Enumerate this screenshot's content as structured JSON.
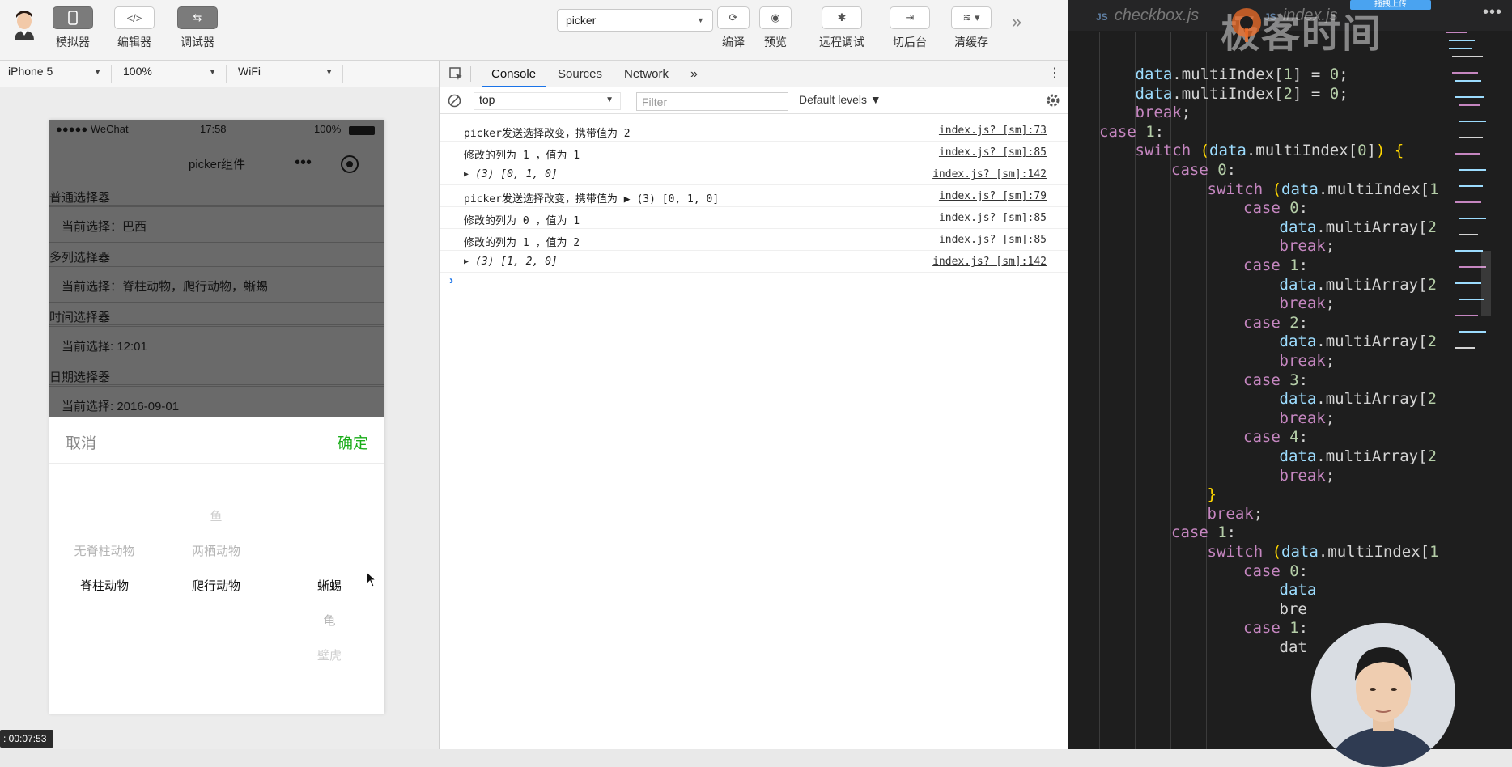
{
  "toolbar": {
    "simulator_label": "模拟器",
    "editor_label": "编辑器",
    "debugger_label": "调试器",
    "project": "picker",
    "compile_label": "编译",
    "preview_label": "预览",
    "remote_debug_label": "远程调试",
    "background_label": "切后台",
    "clear_cache_label": "清缓存"
  },
  "devbar": {
    "device": "iPhone 5",
    "zoom": "100%",
    "network": "WiFi"
  },
  "phone": {
    "carrier": "●●●●● WeChat",
    "time": "17:58",
    "battery": "100%",
    "title": "picker组件",
    "sections": [
      {
        "heading": "普通选择器",
        "value": "当前选择：巴西"
      },
      {
        "heading": "多列选择器",
        "value": "当前选择：脊柱动物，爬行动物，蜥蜴"
      },
      {
        "heading": "时间选择器",
        "value": "当前选择: 12:01"
      },
      {
        "heading": "日期选择器",
        "value": "当前选择: 2016-09-01"
      }
    ],
    "picker": {
      "cancel": "取消",
      "confirm": "确定",
      "col1": [
        "无脊柱动物",
        "脊柱动物"
      ],
      "col2": [
        "鱼",
        "两栖动物",
        "爬行动物"
      ],
      "col3": [
        "蜥蜴",
        "龟",
        "壁虎"
      ]
    }
  },
  "devtools": {
    "tabs": [
      "Console",
      "Sources",
      "Network"
    ],
    "more": "»",
    "context": "top",
    "filter_placeholder": "Filter",
    "levels": "Default levels ▼",
    "logs": [
      {
        "msg": "picker发送选择改变，携带值为 2",
        "src": "index.js? [sm]:73"
      },
      {
        "msg": "修改的列为 1 ，值为 1",
        "src": "index.js? [sm]:85"
      },
      {
        "msg": "(3) [0, 1, 0]",
        "src": "index.js? [sm]:142"
      },
      {
        "msg": "picker发送选择改变，携带值为 ▶ (3) [0, 1, 0]",
        "src": "index.js? [sm]:79"
      },
      {
        "msg": "修改的列为 0 ，值为 1",
        "src": "index.js? [sm]:85"
      },
      {
        "msg": "修改的列为 1 ，值为 2",
        "src": "index.js? [sm]:85"
      },
      {
        "msg": "(3) [1, 2, 0]",
        "src": "index.js? [sm]:142"
      }
    ],
    "prompt": "›"
  },
  "editor": {
    "tab1": "checkbox.js",
    "tab2": "index.js",
    "js_badge": "JS",
    "watermark": "极客时间",
    "upload": "拖拽上传",
    "more": "•••",
    "lines": [
      "data.multiIndex[1] = 0;",
      "data.multiIndex[2] = 0;",
      "break;",
      "case 1:",
      "switch (data.multiIndex[0]) {",
      "case 0:",
      "switch (data.multiIndex[1",
      "case 0:",
      "data.multiArray[2",
      "break;",
      "case 1:",
      "data.multiArray[2",
      "break;",
      "case 2:",
      "data.multiArray[2",
      "break;",
      "case 3:",
      "data.multiArray[2",
      "break;",
      "case 4:",
      "data.multiArray[2",
      "break;",
      "}",
      "break;",
      "case 1:",
      "switch (data.multiIndex[1",
      "case 0:",
      "data",
      "bre",
      "case 1:",
      "dat"
    ]
  },
  "timecode": ": 00:07:53"
}
